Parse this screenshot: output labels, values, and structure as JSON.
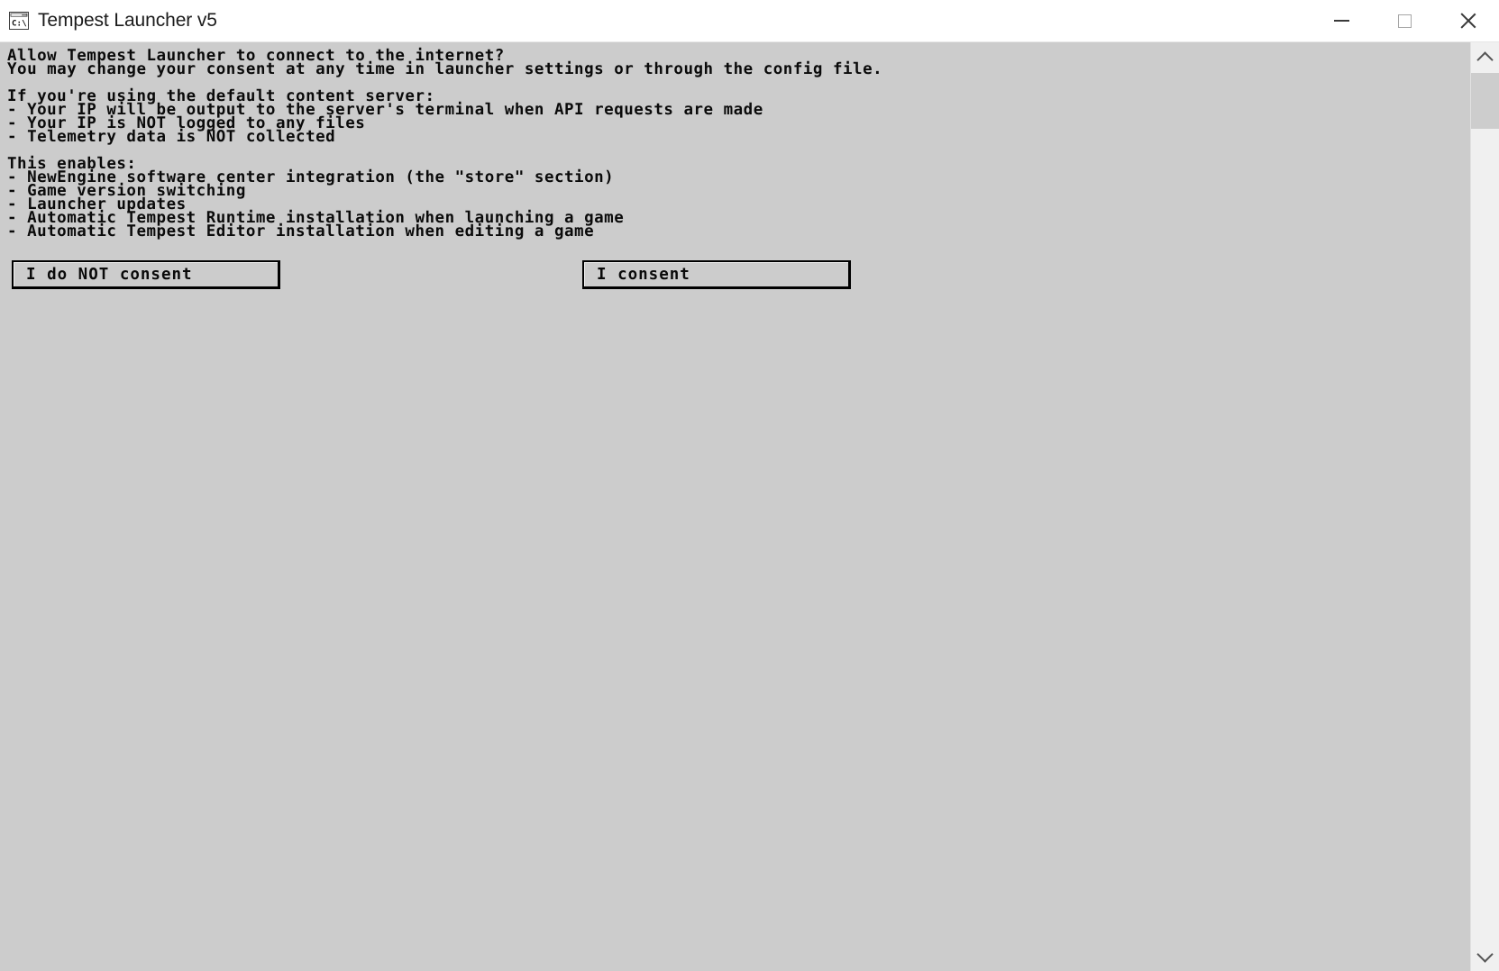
{
  "window": {
    "title": "Tempest Launcher v5",
    "icon": "cmd-console-icon",
    "icon_text": "C:\\",
    "background_color": "#cccccc",
    "titlebar_background": "#ffffff",
    "controls": {
      "minimize": "minimize-icon",
      "maximize": "maximize-icon",
      "close": "close-icon"
    }
  },
  "console": {
    "lines": [
      "Allow Tempest Launcher to connect to the internet?",
      "You may change your consent at any time in launcher settings or through the config file.",
      "",
      "If you're using the default content server:",
      "- Your IP will be output to the server's terminal when API requests are made",
      "- Your IP is NOT logged to any files",
      "- Telemetry data is NOT collected",
      "",
      "This enables:",
      "- NewEngine software center integration (the \"store\" section)",
      "- Game version switching",
      "- Launcher updates",
      "- Automatic Tempest Runtime installation when launching a game",
      "- Automatic Tempest Editor installation when editing a game"
    ]
  },
  "buttons": {
    "decline": "I do NOT consent",
    "accept": "I consent"
  },
  "scrollbar": {
    "up_arrow": "chevron-up-icon",
    "down_arrow": "chevron-down-icon",
    "orientation": "vertical"
  }
}
